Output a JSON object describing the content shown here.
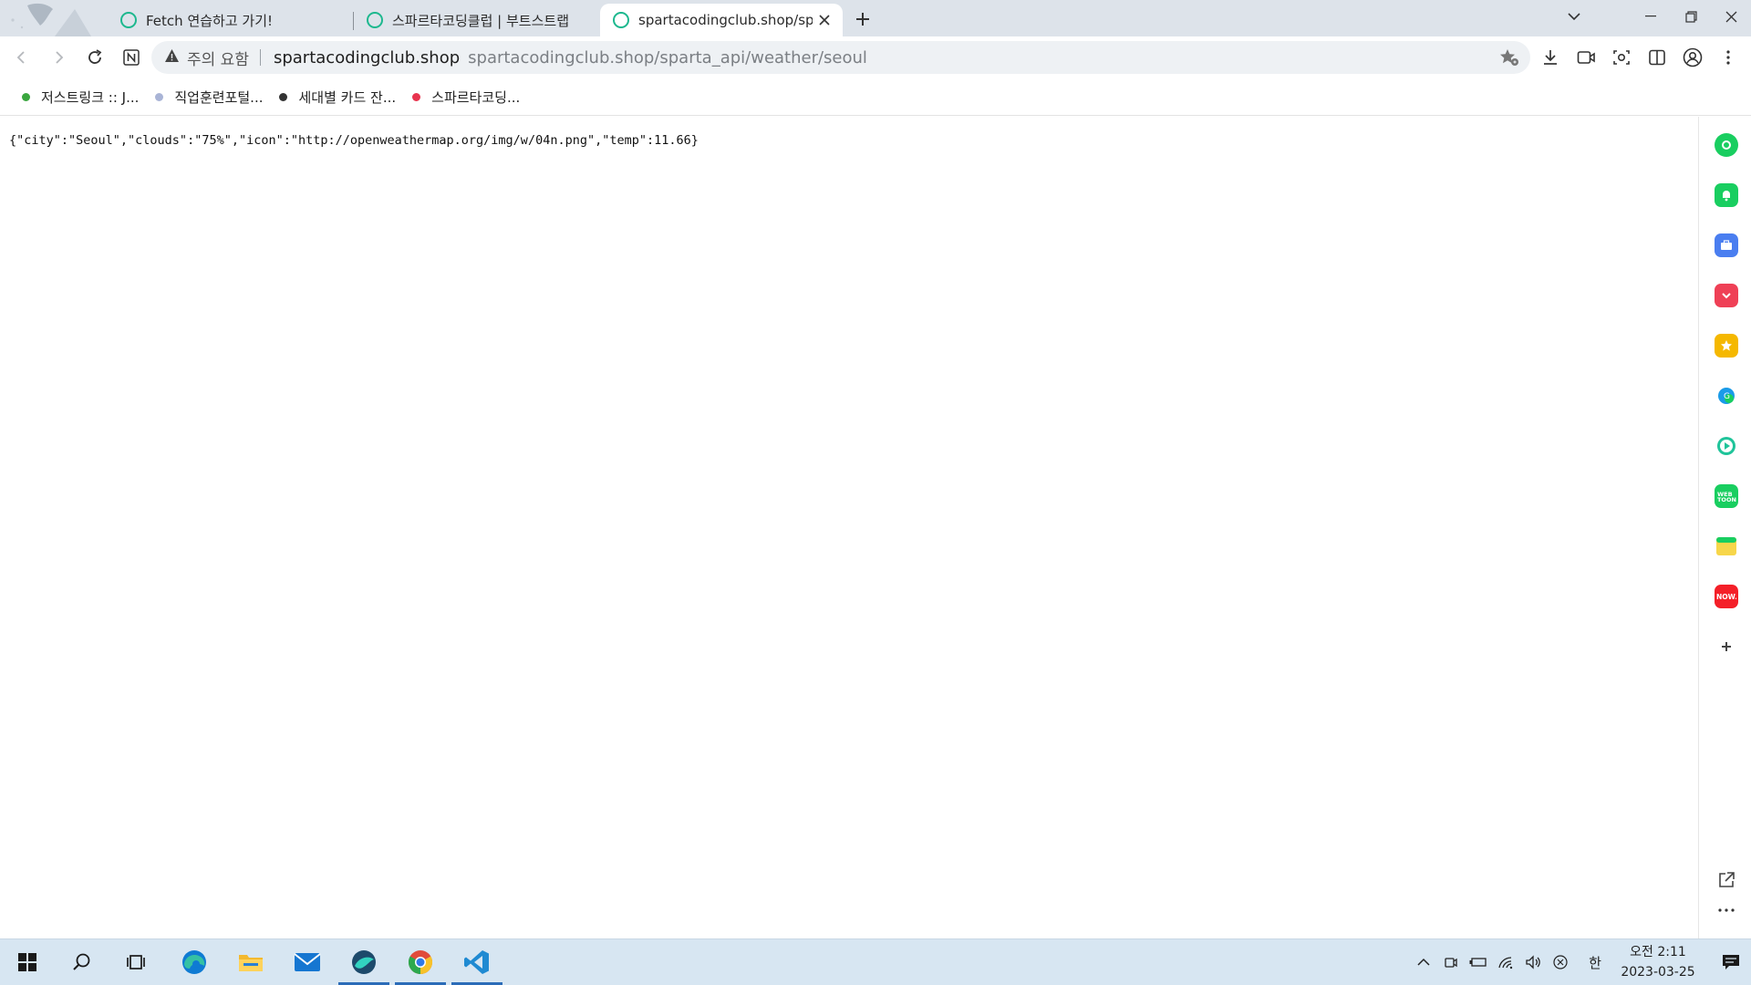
{
  "browser": {
    "tabs": [
      {
        "title": "Fetch 연습하고 가기!",
        "active": false
      },
      {
        "title": "스파르타코딩클럽 | 부트스트랩",
        "active": false
      },
      {
        "title": "spartacodingclub.shop/sparta",
        "active": true
      }
    ],
    "new_tab_icon": "plus-icon",
    "window_controls": [
      "tab-search-icon",
      "minimize-icon",
      "restore-icon",
      "close-icon"
    ]
  },
  "toolbar": {
    "back_icon": "arrow-left-icon",
    "forward_icon": "arrow-right-icon",
    "reload_icon": "reload-icon",
    "home_icon": "naver-n-icon",
    "security_label": "주의 요함",
    "url_host": "spartacodingclub.shop",
    "url_path": "spartacodingclub.shop/sparta_api/weather/seoul",
    "right_icons": [
      "download-icon",
      "video-icon",
      "screen-capture-icon",
      "split-view-icon",
      "profile-icon",
      "more-menu-icon"
    ]
  },
  "bookmarks": [
    {
      "label": "저스트링크 :: J...",
      "color": "#3aa63f"
    },
    {
      "label": "직업훈련포털...",
      "color": "#a9b4d6"
    },
    {
      "label": "세대별 카드 잔...",
      "color": "#333333"
    },
    {
      "label": "스파르타코딩...",
      "color": "#e8344e"
    }
  ],
  "page": {
    "response_text": "{\"city\":\"Seoul\",\"clouds\":\"75%\",\"icon\":\"http://openweathermap.org/img/w/04n.png\",\"temp\":11.66}"
  },
  "sidebar": {
    "items": [
      {
        "name": "naver-green-icon",
        "color": "#19ce60"
      },
      {
        "name": "notification-bell-icon",
        "color": "#19ce60"
      },
      {
        "name": "briefcase-icon",
        "color": "#4a7ef0"
      },
      {
        "name": "pocket-icon",
        "color": "#ef4056"
      },
      {
        "name": "star-icon",
        "color": "#f5b800"
      },
      {
        "name": "papago-icon",
        "color": "#1a9be8"
      },
      {
        "name": "play-icon",
        "color": "#1fc49a"
      },
      {
        "name": "webtoon-icon",
        "color": "#19ce60"
      },
      {
        "name": "memo-icon",
        "color": "#f7d64a"
      },
      {
        "name": "now-icon",
        "color": "#f41f28"
      },
      {
        "name": "add-icon",
        "color": "#444444"
      }
    ],
    "bottom_icons": [
      "open-external-icon",
      "ellipsis-icon"
    ]
  },
  "taskbar": {
    "apps": [
      "windows-start-icon",
      "search-icon",
      "task-view-icon",
      "edge-icon",
      "file-explorer-icon",
      "mail-icon",
      "whale-browser-icon",
      "chrome-icon",
      "vscode-icon"
    ],
    "active_apps": [
      "whale-browser-icon",
      "chrome-icon",
      "vscode-icon"
    ],
    "tray_icons": [
      "chevron-up-icon",
      "meet-icon",
      "battery-icon",
      "wifi-icon",
      "volume-icon",
      "mute-x-icon"
    ],
    "ime": "한",
    "clock_time": "오전 2:11",
    "clock_date": "2023-03-25",
    "notification_icon": "notification-icon"
  }
}
